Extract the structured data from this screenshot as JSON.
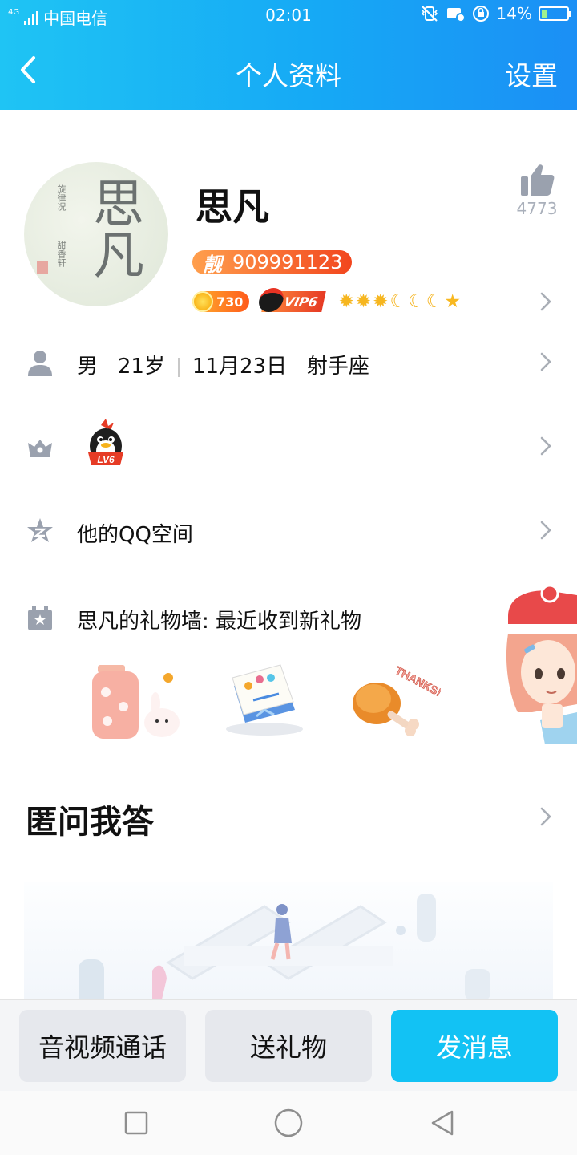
{
  "status_bar": {
    "network": "4G",
    "carrier": "中国电信",
    "time": "02:01",
    "battery": "14%"
  },
  "nav": {
    "back_icon": "chevron-left-icon",
    "title": "个人资料",
    "settings": "设置"
  },
  "profile": {
    "name": "思凡",
    "likes": "4773",
    "qq_tag": "靓",
    "qq_number": "909991123",
    "coin_value": "730",
    "vip_label": "VIP6",
    "level_icons": [
      "sun",
      "sun",
      "sun",
      "moon",
      "moon",
      "moon",
      "star"
    ],
    "avatar_text": "思凡",
    "avatar_small_text": [
      "旋律况",
      "甜香轩"
    ]
  },
  "info_row": {
    "gender": "男",
    "age": "21岁",
    "birthday": "11月23日",
    "zodiac": "射手座"
  },
  "level_row": {
    "badge_label": "LV6"
  },
  "qzone_row": {
    "label": "他的QQ空间"
  },
  "gift_row": {
    "label": "思凡的礼物墙: 最近收到新礼物",
    "gifts": [
      "cherry-blossom-jar-with-rabbit",
      "birthday-card",
      "roast-drumstick-thanks"
    ],
    "drumstick_text": "THANKS!"
  },
  "qa_section": {
    "title": "匿问我答"
  },
  "bottom_bar": {
    "call": "音视频通话",
    "gift": "送礼物",
    "message": "发消息"
  },
  "colors": {
    "header_gradient": [
      "#1fc4f4",
      "#1b8ff5"
    ],
    "primary": "#12c2f4",
    "id_badge": "#f2461e"
  }
}
